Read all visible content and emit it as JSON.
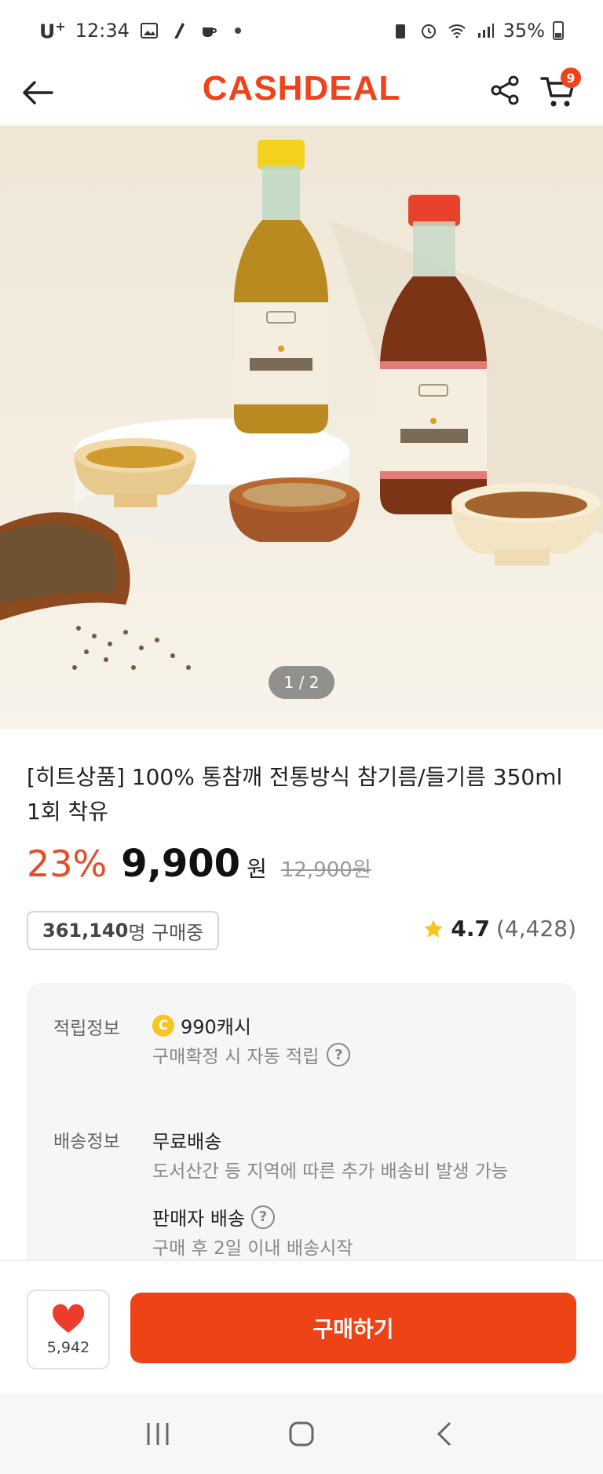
{
  "status_bar": {
    "carrier": "U",
    "carrier_sup": "+",
    "time": "12:34",
    "battery": "35%"
  },
  "header": {
    "logo": "CASHDEAL",
    "cart_count": "9",
    "icons": [
      "back-arrow-icon",
      "share-icon",
      "cart-icon"
    ]
  },
  "gallery": {
    "indicator": "1 / 2"
  },
  "product": {
    "title": "[히트상품] 100% 통참깨 전통방식 참기름/들기름 350ml 1회 착유",
    "discount": "23%",
    "price": "9,900",
    "currency": "원",
    "original_price": "12,900원",
    "buyers_count": "361,140",
    "buyers_suffix": "명 구매중",
    "rating": "4.7",
    "review_count": "(4,428)"
  },
  "info": {
    "reward_label": "적립정보",
    "reward_coin": "C",
    "reward_value": "990캐시",
    "reward_sub": "구매확정 시 자동 적립",
    "shipping_label": "배송정보",
    "shipping_value": "무료배송",
    "shipping_sub": "도서산간 등 지역에 따른 추가 배송비 발생 가능",
    "seller_shipping": "판매자 배송",
    "seller_shipping_sub": "구매 후 2일 이내 배송시작",
    "help_glyph": "?"
  },
  "bottom_bar": {
    "likes": "5,942",
    "buy_label": "구매하기"
  },
  "colors": {
    "brand": "#f0421b",
    "buy_button": "#ee4316",
    "discount": "#e84a2a",
    "heart": "#ee3b2d",
    "star": "#f7c520"
  }
}
